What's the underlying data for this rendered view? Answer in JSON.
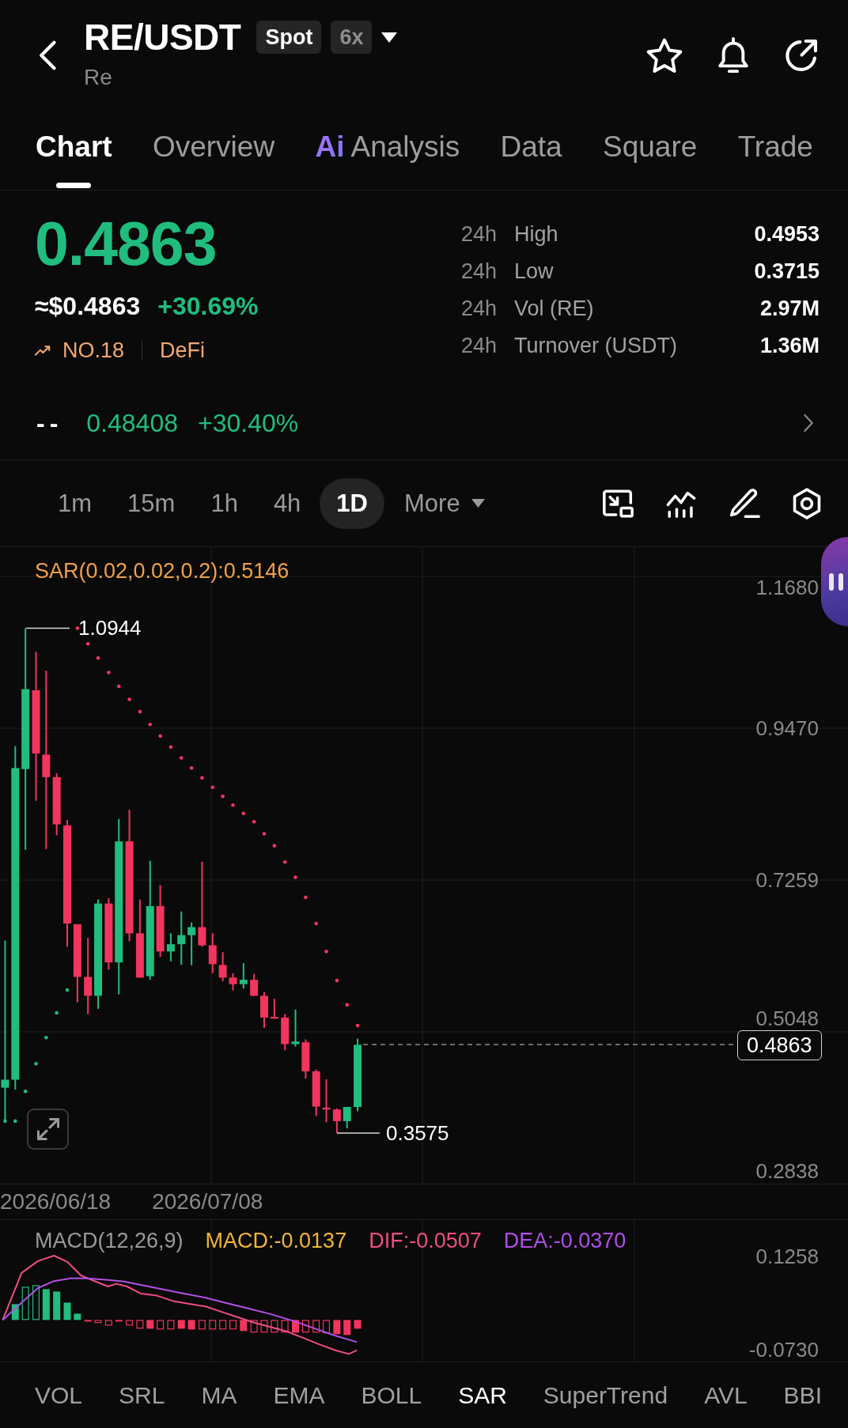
{
  "header": {
    "title": "RE/USDT",
    "badges": [
      {
        "label": "Spot",
        "kind": "market"
      },
      {
        "label": "6x",
        "kind": "leverage"
      }
    ],
    "subtitle": "Re"
  },
  "tabs": [
    {
      "label": "Chart",
      "selected": true
    },
    {
      "label": "Overview",
      "selected": false
    },
    {
      "label": "Analysis",
      "selected": false,
      "tag": "Ai"
    },
    {
      "label": "Data",
      "selected": false
    },
    {
      "label": "Square",
      "selected": false
    },
    {
      "label": "Trade",
      "selected": false
    }
  ],
  "quote": {
    "price": "0.4863",
    "rising": true,
    "fiat": "≈$0.4863",
    "change": "+30.69%",
    "rank": "NO.18",
    "category": "DeFi"
  },
  "stats": [
    {
      "period": "24h",
      "label": "High",
      "value": "0.4953"
    },
    {
      "period": "24h",
      "label": "Low",
      "value": "0.3715"
    },
    {
      "period": "24h",
      "label": "Vol (RE)",
      "value": "2.97M"
    },
    {
      "period": "24h",
      "label": "Turnover (USDT)",
      "value": "1.36M"
    }
  ],
  "index_row": {
    "label": "--",
    "price": "0.48408",
    "change": "+30.40%",
    "rising": true
  },
  "intervals": [
    {
      "label": "1m",
      "selected": false
    },
    {
      "label": "15m",
      "selected": false
    },
    {
      "label": "1h",
      "selected": false
    },
    {
      "label": "4h",
      "selected": false
    },
    {
      "label": "1D",
      "selected": true
    }
  ],
  "more_button": "More",
  "chart": {
    "legend": "SAR(0.02,0.02,0.2):0.5146",
    "price_axis": [
      "1.1680",
      "0.9470",
      "0.7259",
      "0.5048",
      "0.2838"
    ],
    "high_label": "1.0944",
    "low_label": "0.3575",
    "last_price": "0.4863",
    "dates": [
      "2026/06/18",
      "2026/07/08"
    ]
  },
  "macd": {
    "legend": [
      {
        "text": "MACD(12,26,9)",
        "color": "#9a9a9a"
      },
      {
        "text": "MACD:-0.0137",
        "color": "#f2b53a"
      },
      {
        "text": "DIF:-0.0507",
        "color": "#ee4d86"
      },
      {
        "text": "DEA:-0.0370",
        "color": "#b24fe6"
      }
    ],
    "axis": [
      "0.1258",
      "-0.0730"
    ]
  },
  "indicators": [
    {
      "label": "VOL",
      "selected": false
    },
    {
      "label": "SRL",
      "selected": false
    },
    {
      "label": "MA",
      "selected": false
    },
    {
      "label": "EMA",
      "selected": false
    },
    {
      "label": "BOLL",
      "selected": false
    },
    {
      "label": "SAR",
      "selected": true
    },
    {
      "label": "SuperTrend",
      "selected": false
    },
    {
      "label": "AVL",
      "selected": false
    },
    {
      "label": "BBI",
      "selected": false
    }
  ]
}
